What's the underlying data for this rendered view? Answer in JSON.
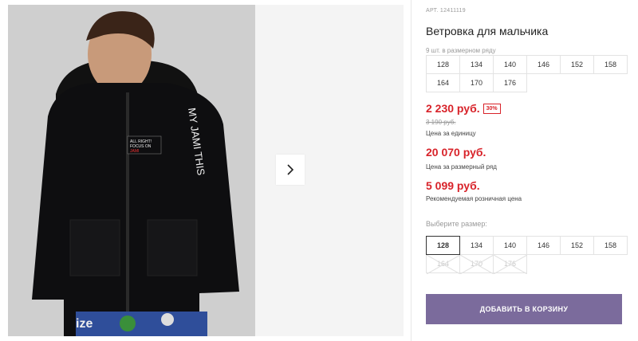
{
  "product": {
    "sku_label": "АРТ.",
    "sku": "12411119",
    "title": "Ветровка для мальчика",
    "pack_note": "9 шт. в размерном ряду",
    "pack_sizes": [
      "128",
      "134",
      "140",
      "146",
      "152",
      "158",
      "164",
      "170",
      "176"
    ]
  },
  "prices": {
    "unit_price": "2 230 руб.",
    "discount": "30%",
    "old_price": "3 190 руб.",
    "unit_note": "Цена за единицу",
    "pack_price": "20 070 руб.",
    "pack_note": "Цена за размерный ряд",
    "retail_price": "5 099 руб.",
    "retail_note": "Рекомендуемая розничная цена"
  },
  "size_select": {
    "label": "Выберите размер:",
    "selected": "128",
    "sizes": [
      {
        "label": "128",
        "state": "selected"
      },
      {
        "label": "134",
        "state": "available"
      },
      {
        "label": "140",
        "state": "available"
      },
      {
        "label": "146",
        "state": "available"
      },
      {
        "label": "152",
        "state": "available"
      },
      {
        "label": "158",
        "state": "available"
      },
      {
        "label": "164",
        "state": "disabled"
      },
      {
        "label": "170",
        "state": "disabled"
      },
      {
        "label": "176",
        "state": "disabled"
      }
    ]
  },
  "actions": {
    "add_to_cart": "ДОБАВИТЬ В КОРЗИНУ"
  },
  "colors": {
    "accent": "#7b6b9c",
    "price_red": "#d8232a"
  },
  "gallery": {
    "next_icon": "chevron-right-icon",
    "jacket_text_sleeve": "MY JAMI THIS",
    "jacket_patch_lines": [
      "ALL RIGHT!",
      "FOCUS ON",
      "JAMI"
    ],
    "pants_text": "ize"
  }
}
